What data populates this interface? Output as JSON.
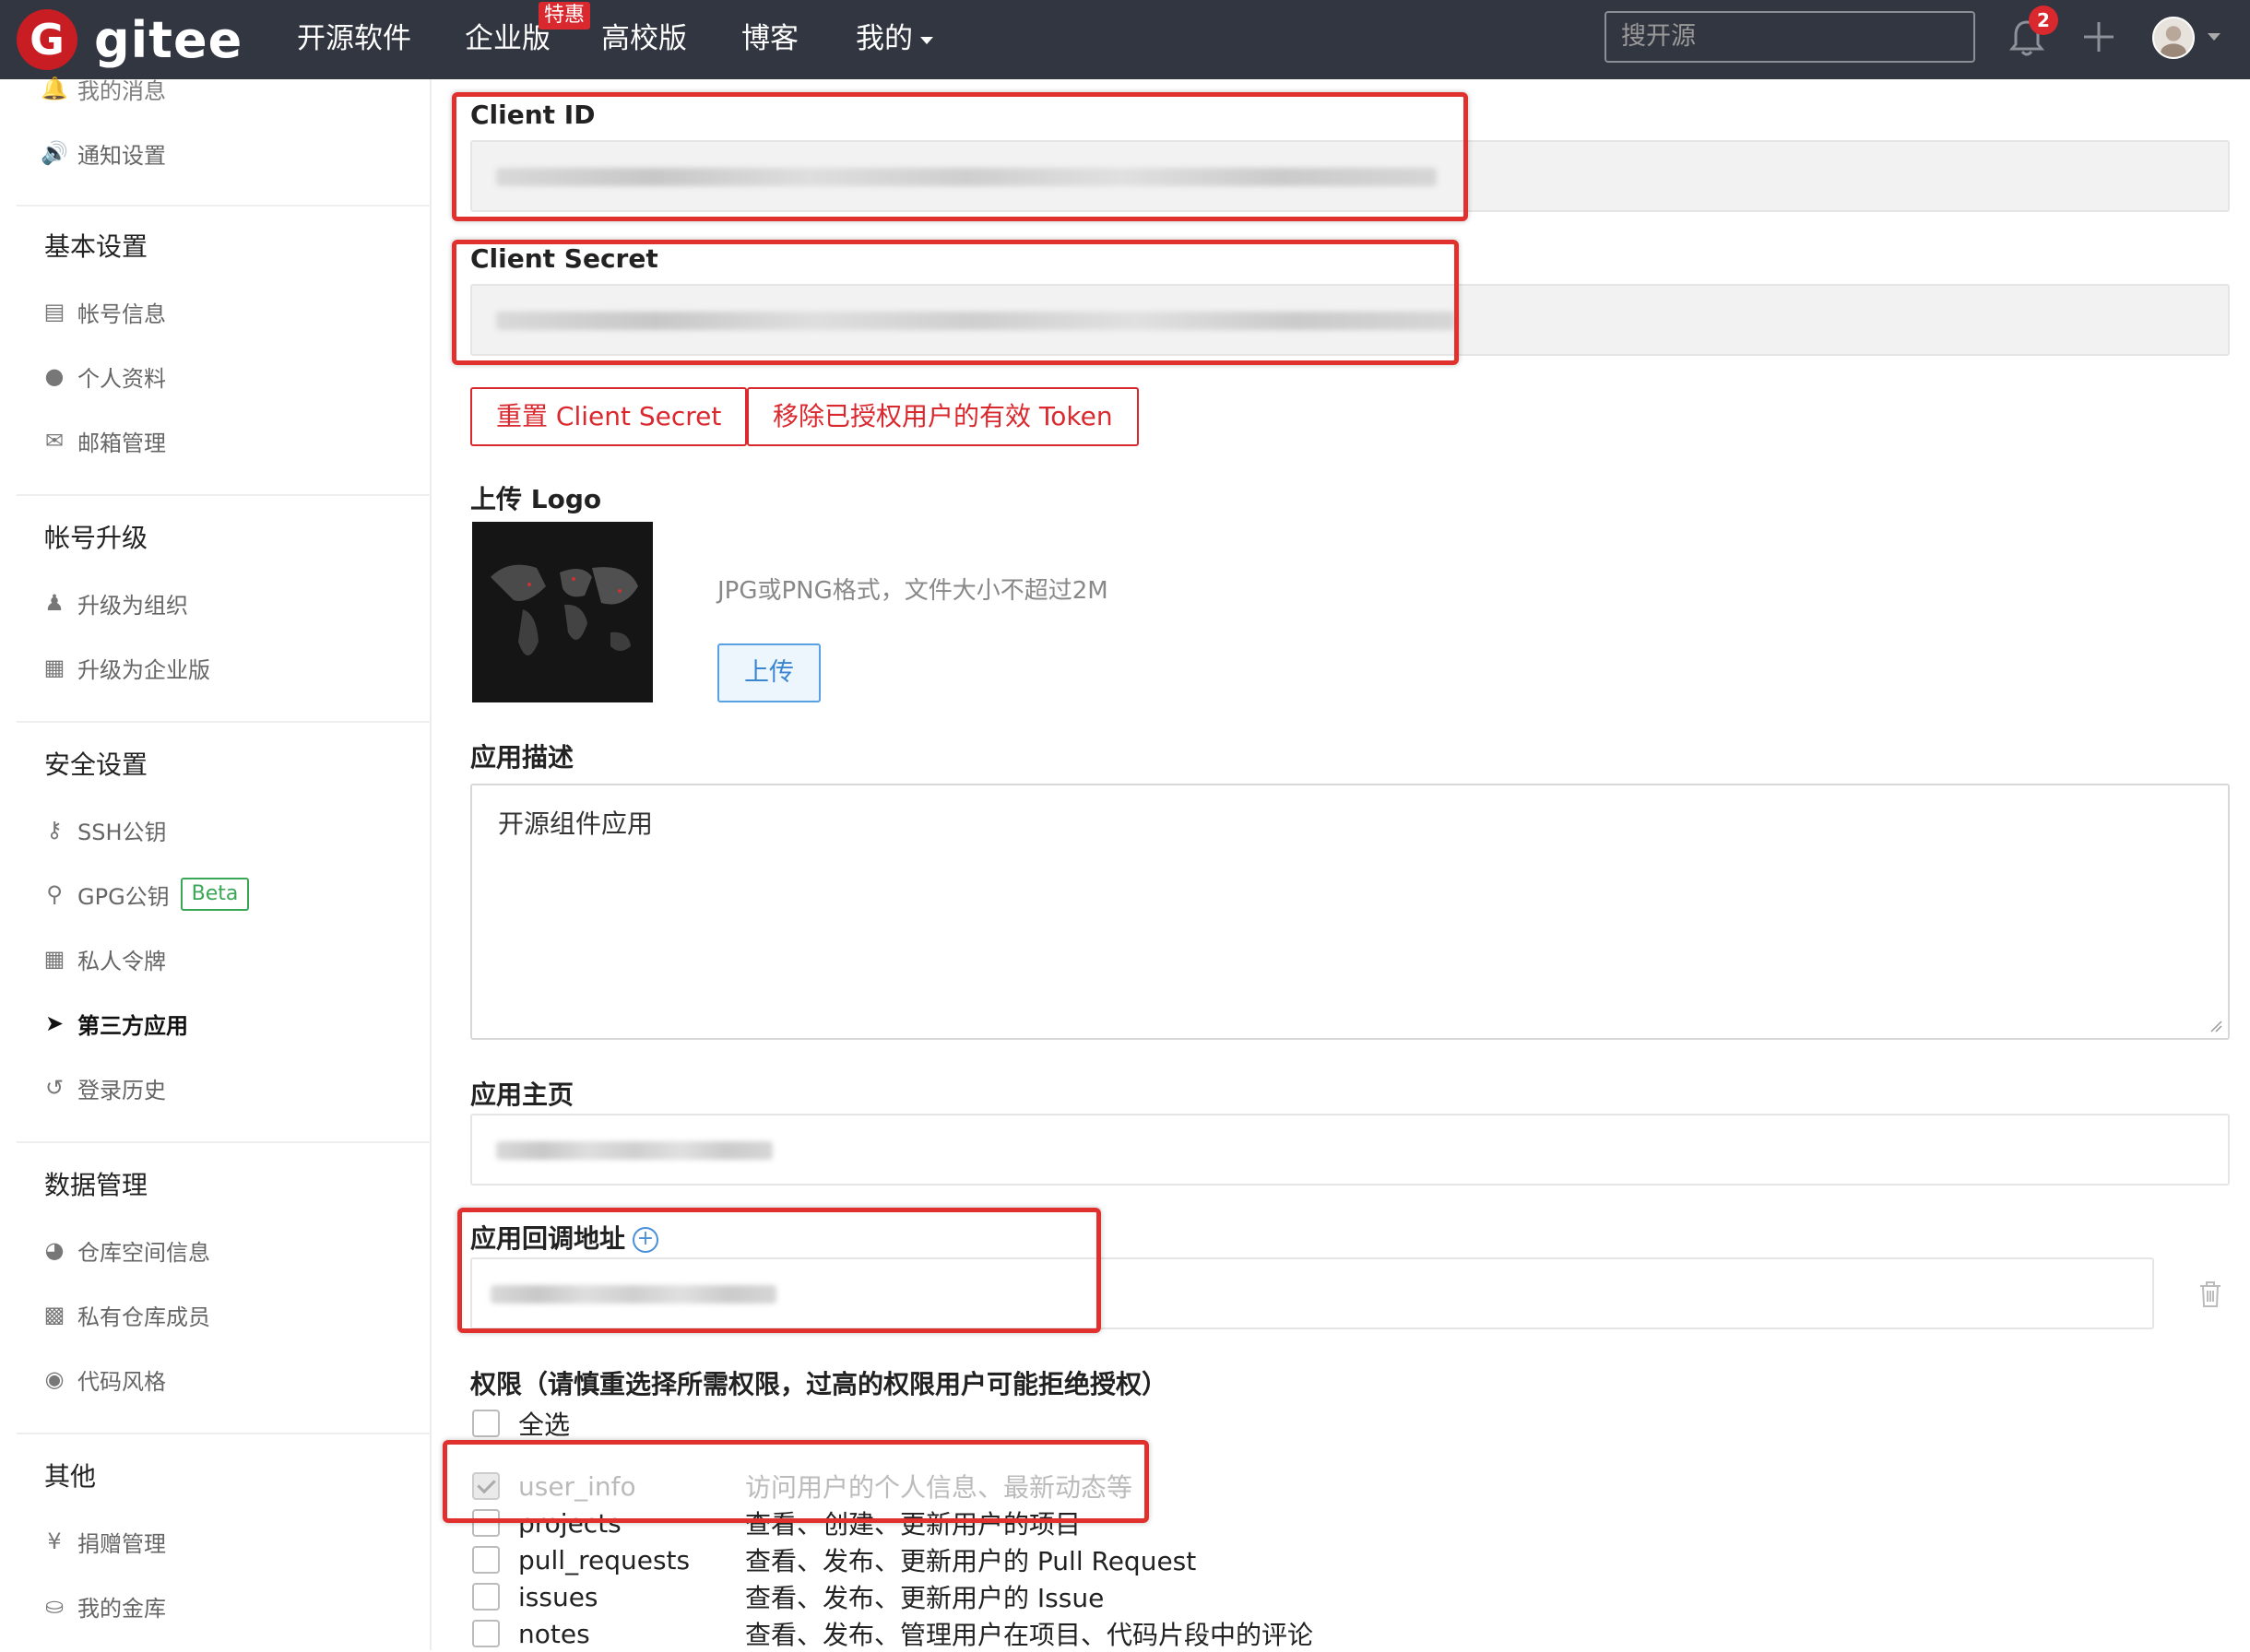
{
  "nav": {
    "brand": "gitee",
    "logo_letter": "G",
    "links": [
      "开源软件",
      "企业版",
      "高校版",
      "博客",
      "我的"
    ],
    "hot_badge": "特惠",
    "search_placeholder": "搜开源",
    "notification_count": "2"
  },
  "sidebar": {
    "top_items": [
      {
        "label": "我的消息",
        "icon": "bell-icon"
      },
      {
        "label": "通知设置",
        "icon": "volume-icon"
      }
    ],
    "sections": [
      {
        "title": "基本设置",
        "items": [
          {
            "label": "帐号信息",
            "icon": "id-card-icon"
          },
          {
            "label": "个人资料",
            "icon": "user-icon"
          },
          {
            "label": "邮箱管理",
            "icon": "envelope-icon"
          }
        ]
      },
      {
        "title": "帐号升级",
        "items": [
          {
            "label": "升级为组织",
            "icon": "users-icon"
          },
          {
            "label": "升级为企业版",
            "icon": "building-icon"
          }
        ]
      },
      {
        "title": "安全设置",
        "items": [
          {
            "label": "SSH公钥",
            "icon": "key-icon"
          },
          {
            "label": "GPG公钥",
            "icon": "lock-icon",
            "badge": "Beta"
          },
          {
            "label": "私人令牌",
            "icon": "token-icon"
          },
          {
            "label": "第三方应用",
            "icon": "rocket-icon",
            "active": true
          },
          {
            "label": "登录历史",
            "icon": "history-icon"
          }
        ]
      },
      {
        "title": "数据管理",
        "items": [
          {
            "label": "仓库空间信息",
            "icon": "pie-chart-icon"
          },
          {
            "label": "私有仓库成员",
            "icon": "contact-icon"
          },
          {
            "label": "代码风格",
            "icon": "palette-icon"
          }
        ]
      },
      {
        "title": "其他",
        "items": [
          {
            "label": "捐赠管理",
            "icon": "yen-icon"
          },
          {
            "label": "我的金库",
            "icon": "coins-icon"
          }
        ]
      }
    ]
  },
  "form": {
    "client_id_label": "Client ID",
    "client_secret_label": "Client Secret",
    "reset_secret_button": "重置 Client Secret",
    "revoke_tokens_button": "移除已授权用户的有效 Token",
    "upload_logo_label": "上传 Logo",
    "upload_hint": "JPG或PNG格式，文件大小不超过2M",
    "upload_button": "上传",
    "description_label": "应用描述",
    "description_value": "开源组件应用",
    "homepage_label": "应用主页",
    "callback_label": "应用回调地址",
    "permissions_label": "权限（请慎重选择所需权限，过高的权限用户可能拒绝授权）",
    "select_all_label": "全选",
    "permissions": [
      {
        "name": "user_info",
        "desc": "访问用户的个人信息、最新动态等",
        "checked": true,
        "disabled": true
      },
      {
        "name": "projects",
        "desc": "查看、创建、更新用户的项目",
        "checked": false
      },
      {
        "name": "pull_requests",
        "desc": "查看、发布、更新用户的 Pull Request",
        "checked": false
      },
      {
        "name": "issues",
        "desc": "查看、发布、更新用户的 Issue",
        "checked": false
      },
      {
        "name": "notes",
        "desc": "查看、发布、管理用户在项目、代码片段中的评论",
        "checked": false
      }
    ]
  },
  "colors": {
    "nav_bg": "#313640",
    "brand_red": "#c71d23",
    "danger": "#d9282e",
    "highlight": "#e0312f",
    "beta_green": "#3aa757",
    "link_blue": "#4a90d9"
  }
}
